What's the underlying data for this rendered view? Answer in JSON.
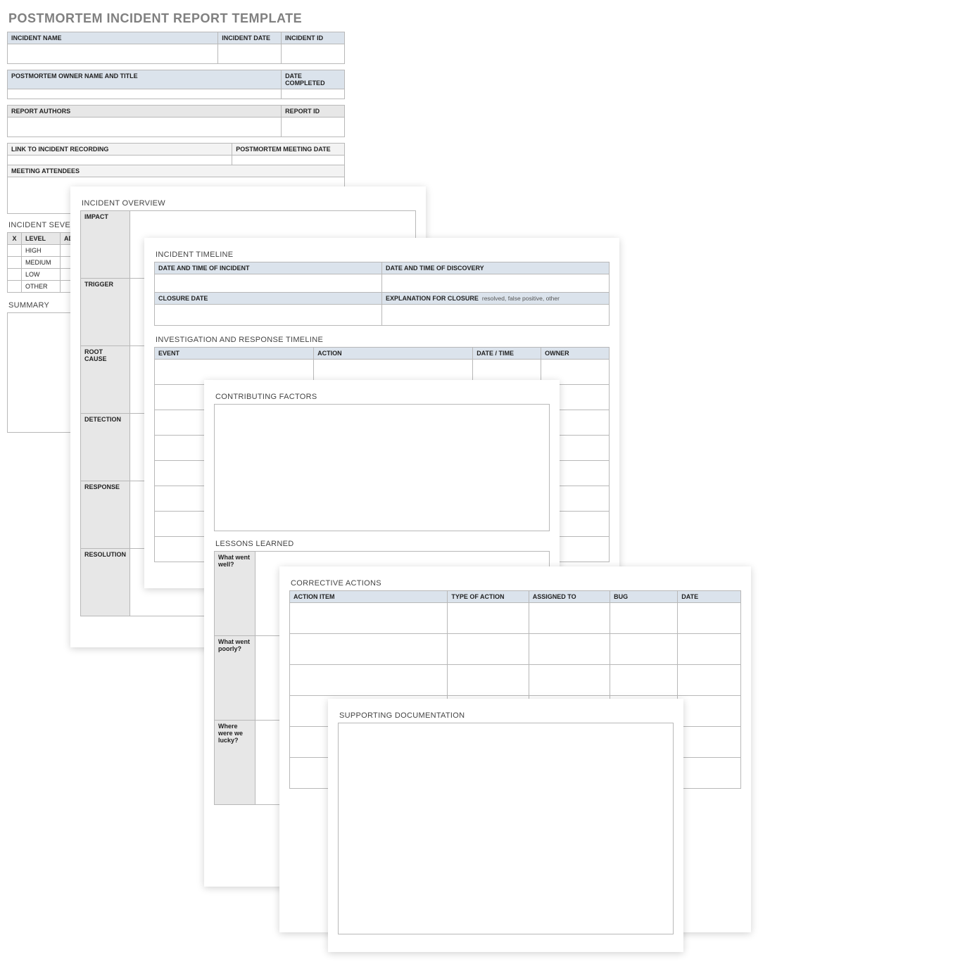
{
  "title": "POSTMORTEM INCIDENT REPORT TEMPLATE",
  "topBlock": {
    "incidentName": "INCIDENT NAME",
    "incidentDate": "INCIDENT DATE",
    "incidentId": "INCIDENT ID",
    "ownerNameTitle": "POSTMORTEM OWNER NAME AND TITLE",
    "dateCompleted": "DATE COMPLETED",
    "reportAuthors": "REPORT AUTHORS",
    "reportId": "REPORT ID",
    "linkRecording": "LINK TO INCIDENT RECORDING",
    "meetingDate": "POSTMORTEM MEETING DATE",
    "attendees": "MEETING ATTENDEES"
  },
  "severity": {
    "title": "INCIDENT SEVERITY",
    "colX": "X",
    "colLevel": "LEVEL",
    "colAdd": "ADD",
    "levels": [
      "HIGH",
      "MEDIUM",
      "LOW",
      "OTHER"
    ]
  },
  "summaryTitle": "SUMMARY",
  "overview": {
    "title": "INCIDENT OVERVIEW",
    "rows": [
      "IMPACT",
      "TRIGGER",
      "ROOT CAUSE",
      "DETECTION",
      "RESPONSE",
      "RESOLUTION"
    ]
  },
  "timeline": {
    "title": "INCIDENT TIMELINE",
    "dtIncident": "DATE AND TIME OF INCIDENT",
    "dtDiscovery": "DATE AND TIME OF DISCOVERY",
    "closureDate": "CLOSURE DATE",
    "closureExpl": "EXPLANATION FOR CLOSURE",
    "closureHint": "resolved, false positive, other",
    "investTitle": "INVESTIGATION AND RESPONSE TIMELINE",
    "cols": [
      "EVENT",
      "ACTION",
      "DATE / TIME",
      "OWNER"
    ]
  },
  "contrib": {
    "title": "CONTRIBUTING FACTORS"
  },
  "lessons": {
    "title": "LESSONS LEARNED",
    "rows": [
      "What went well?",
      "What went poorly?",
      "Where were we lucky?"
    ]
  },
  "corrective": {
    "title": "CORRECTIVE ACTIONS",
    "cols": [
      "ACTION ITEM",
      "TYPE OF ACTION",
      "ASSIGNED TO",
      "BUG",
      "DATE"
    ]
  },
  "supporting": {
    "title": "SUPPORTING DOCUMENTATION"
  }
}
